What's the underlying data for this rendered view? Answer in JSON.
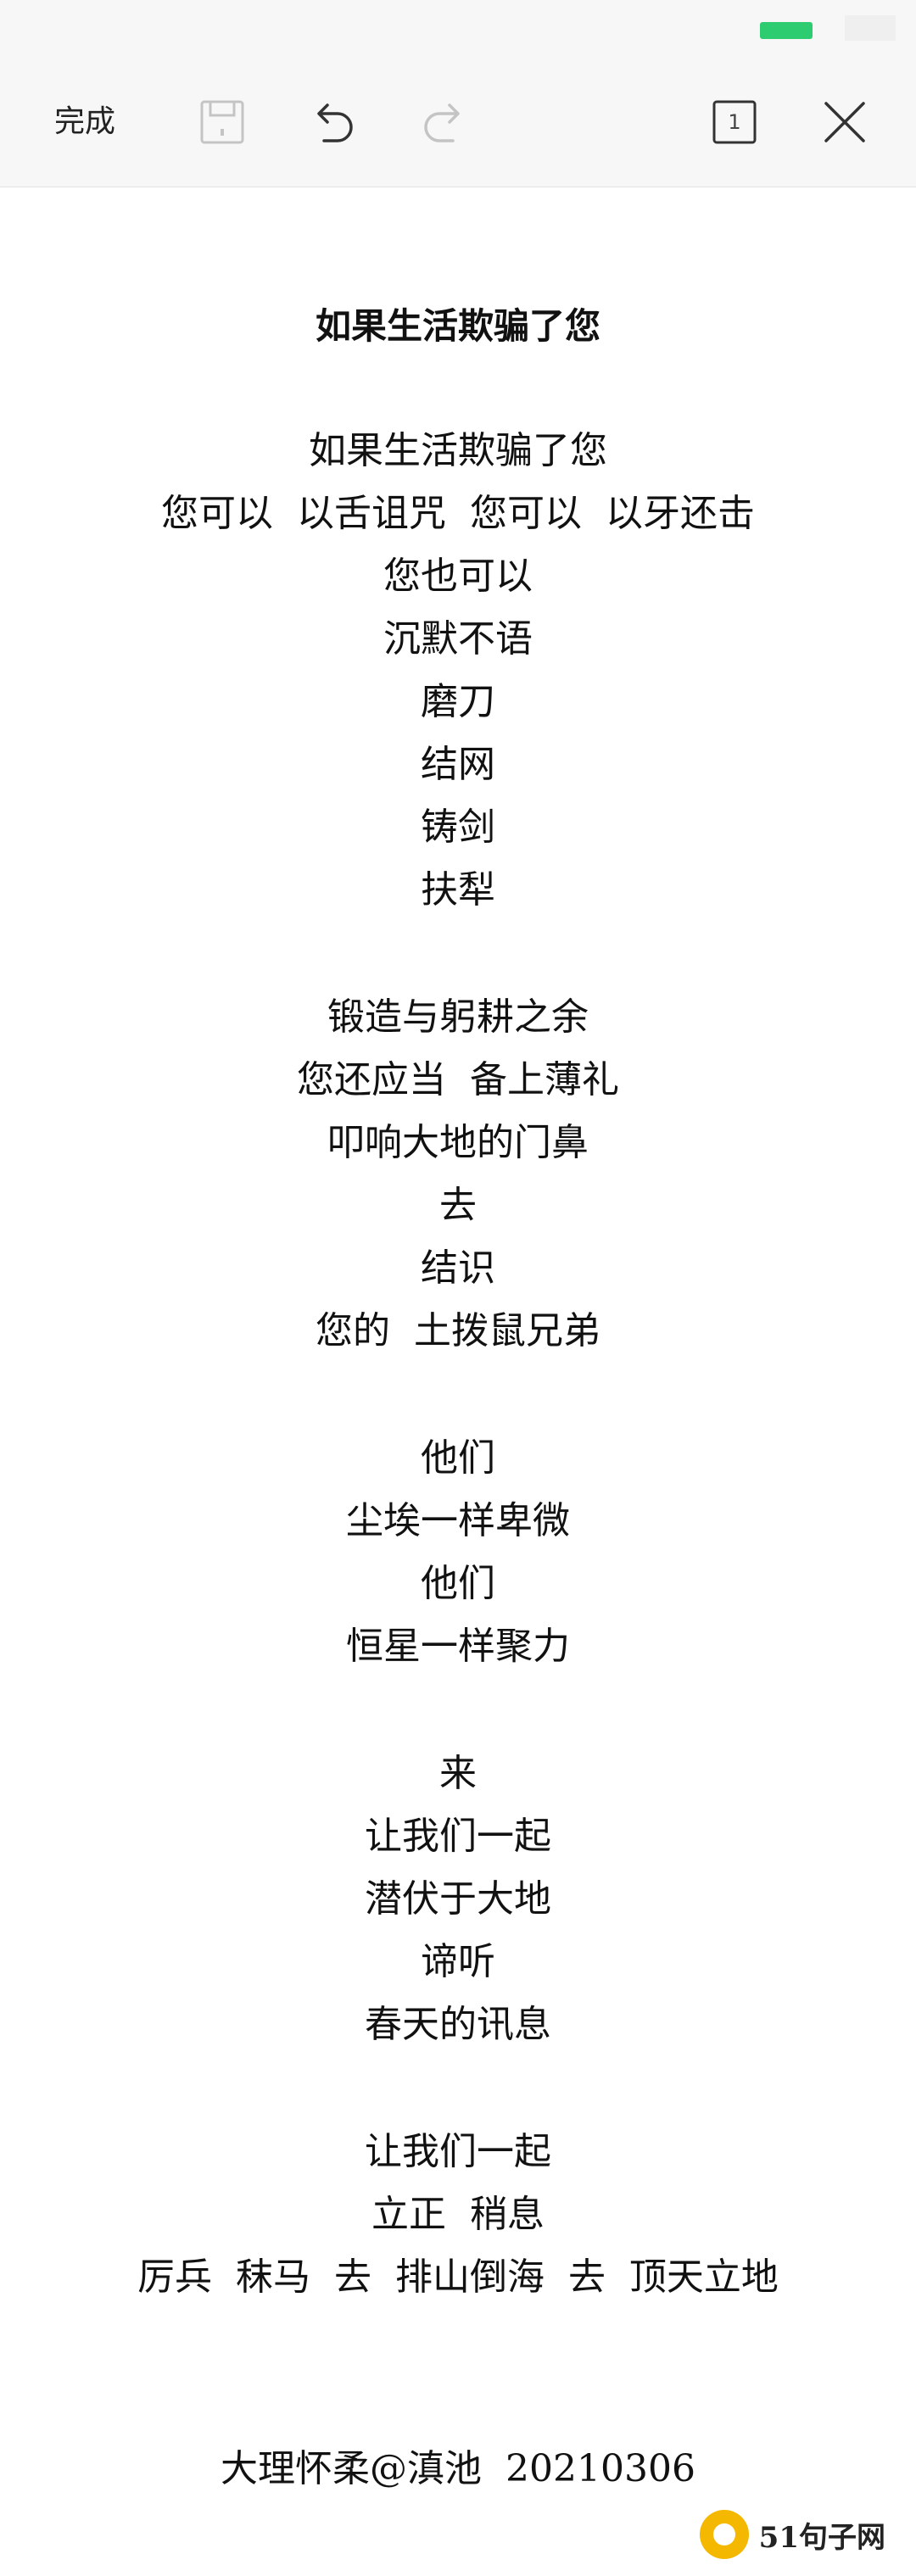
{
  "toolbar": {
    "done_label": "完成",
    "page_count": "1",
    "icons": [
      "save-icon",
      "undo-icon",
      "redo-icon",
      "page-icon",
      "close-icon"
    ]
  },
  "poem": {
    "title": "如果生活欺骗了您",
    "stanzas": [
      [
        "如果生活欺骗了您",
        "您可以  以舌诅咒  您可以  以牙还击",
        "您也可以",
        "沉默不语",
        "磨刀",
        "结网",
        "铸剑",
        "扶犁"
      ],
      [
        "锻造与躬耕之余",
        "您还应当  备上薄礼",
        "叩响大地的门鼻",
        "去",
        "结识",
        "您的  土拨鼠兄弟"
      ],
      [
        "他们",
        "尘埃一样卑微",
        "他们",
        "恒星一样聚力"
      ],
      [
        "来",
        "让我们一起",
        "潜伏于大地",
        "谛听",
        "春天的讯息"
      ],
      [
        "让我们一起",
        "立正  稍息",
        "厉兵  秣马  去  排山倒海  去  顶天立地"
      ]
    ],
    "signature": "大理怀柔@滇池  20210306"
  },
  "watermark": {
    "text": "51句子网"
  },
  "colors": {
    "battery": "#2ecc71",
    "toolbar_bg": "#f7f7f7",
    "watermark_logo": "#f5b800"
  }
}
